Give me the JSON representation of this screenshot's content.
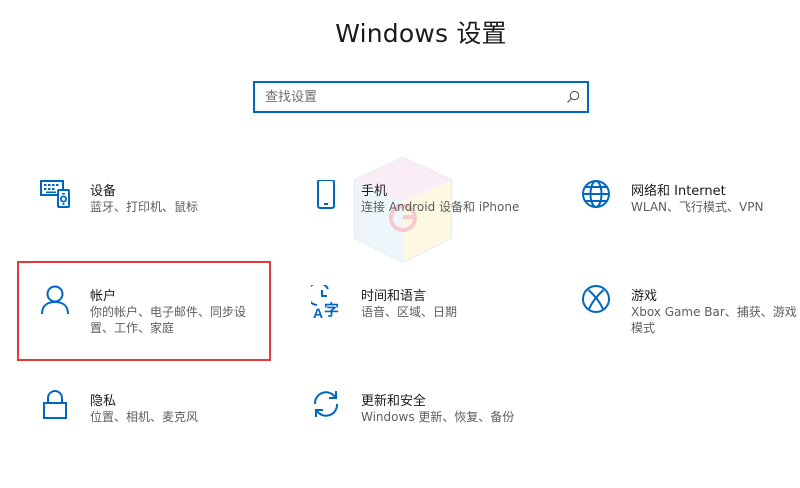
{
  "window": {
    "title": "Windows 设置"
  },
  "search": {
    "placeholder": "查找设置",
    "value": ""
  },
  "accent_color": "#0067c0",
  "highlight_color": "#e03c3c",
  "tiles": [
    {
      "title": "设备",
      "desc": "蓝牙、打印机、鼠标",
      "icon": "devices-icon"
    },
    {
      "title": "手机",
      "desc": "连接 Android 设备和 iPhone",
      "icon": "phone-icon"
    },
    {
      "title": "网络和 Internet",
      "desc": "WLAN、飞行模式、VPN",
      "icon": "globe-icon"
    },
    {
      "title": "帐户",
      "desc": "你的帐户、电子邮件、同步设置、工作、家庭",
      "icon": "person-icon"
    },
    {
      "title": "时间和语言",
      "desc": "语音、区域、日期",
      "icon": "time-language-icon"
    },
    {
      "title": "游戏",
      "desc": "Xbox Game Bar、捕获、游戏模式",
      "icon": "xbox-icon"
    },
    {
      "title": "隐私",
      "desc": "位置、相机、麦克风",
      "icon": "lock-icon"
    },
    {
      "title": "更新和安全",
      "desc": "Windows 更新、恢复、备份",
      "icon": "sync-icon"
    }
  ]
}
